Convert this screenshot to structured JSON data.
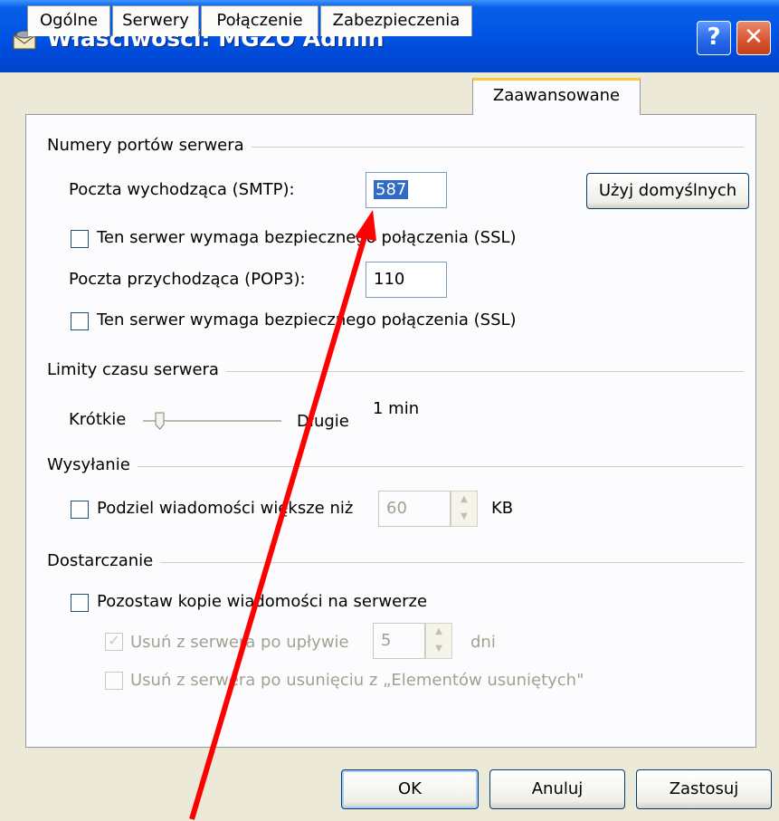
{
  "window": {
    "title": "Właściwości: MGZO Admin",
    "help_glyph": "?",
    "close_glyph": "✕"
  },
  "tabs": [
    {
      "label": "Ogólne"
    },
    {
      "label": "Serwery"
    },
    {
      "label": "Połączenie"
    },
    {
      "label": "Zabezpieczenia"
    },
    {
      "label": "Zaawansowane",
      "active": true
    }
  ],
  "ports": {
    "group_label": "Numery portów serwera",
    "smtp_label": "Poczta wychodząca (SMTP):",
    "smtp_value": "587",
    "defaults_button": "Użyj domyślnych",
    "smtp_ssl_label": "Ten serwer wymaga bezpiecznego połączenia (SSL)",
    "smtp_ssl_checked": false,
    "pop3_label": "Poczta przychodząca (POP3):",
    "pop3_value": "110",
    "pop3_ssl_label": "Ten serwer wymaga bezpiecznego połączenia (SSL)",
    "pop3_ssl_checked": false
  },
  "timeouts": {
    "group_label": "Limity czasu serwera",
    "short_label": "Krótkie",
    "long_label": "Długie",
    "value_text": "1 min",
    "slider_level": 0.1
  },
  "sending": {
    "group_label": "Wysyłanie",
    "split_label": "Podziel wiadomości większe niż",
    "split_value": "60",
    "unit": "KB",
    "split_checked": false
  },
  "delivery": {
    "group_label": "Dostarczanie",
    "leave_copy_label": "Pozostaw kopie wiadomości na serwerze",
    "leave_copy_checked": false,
    "remove_after_label": "Usuń z serwera po upływie",
    "remove_after_value": "5",
    "days_unit": "dni",
    "remove_after_checked": true,
    "remove_deleted_label": "Usuń z serwera po usunięciu z „Elementów usuniętych\"",
    "remove_deleted_checked": false
  },
  "buttons": {
    "ok": "OK",
    "cancel": "Anuluj",
    "apply": "Zastosuj"
  },
  "colors": {
    "annotation_arrow": "#ff0000",
    "titlebar": "#0055e5",
    "active_tab_accent": "#ffc83c"
  }
}
